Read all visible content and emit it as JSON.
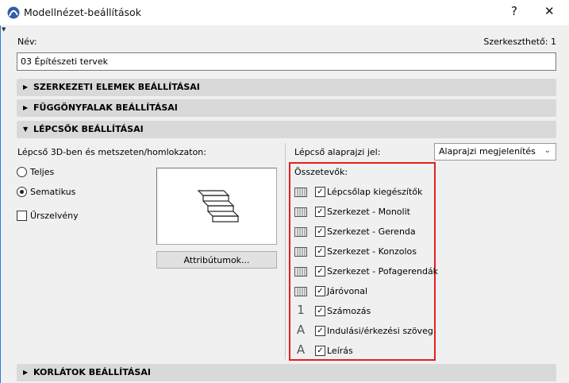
{
  "window": {
    "title": "Modellnézet-beállítások",
    "help_label": "?",
    "close_label": "✕"
  },
  "name": {
    "label": "Név:",
    "value": "03 Építészeti tervek",
    "editable_label": "Szerkeszthető: 1"
  },
  "sections": [
    {
      "label": "SZERKEZETI ELEMEK BEÁLLÍTÁSAI",
      "expanded": false
    },
    {
      "label": "FÜGGÖNYFALAK BEÁLLÍTÁSAI",
      "expanded": false
    },
    {
      "label": "LÉPCSŐK BEÁLLÍTÁSAI",
      "expanded": true
    },
    {
      "label": "KORLÁTOK BEÁLLÍTÁSAI",
      "expanded": false
    }
  ],
  "stairs": {
    "mode_label": "Lépcső 3D-ben és metszeten/homlokzaton:",
    "radio_full": "Teljes",
    "radio_schematic": "Sematikus",
    "selected": "Sematikus",
    "boundary_label": "Űrszelvény",
    "boundary_checked": false,
    "attributes_button": "Attribútumok...",
    "floorplan_label": "Lépcső alaprajzi jel:",
    "floorplan_value": "Alaprajzi megjelenítés",
    "components_label": "Összetevők:",
    "components": [
      {
        "label": "Lépcsőlap kiegészítők",
        "icon": "tread-accessories-icon",
        "checked": true
      },
      {
        "label": "Szerkezet - Monolit",
        "icon": "structure-monolithic-icon",
        "checked": true
      },
      {
        "label": "Szerkezet - Gerenda",
        "icon": "structure-beam-icon",
        "checked": true
      },
      {
        "label": "Szerkezet - Konzolos",
        "icon": "structure-cantilever-icon",
        "checked": true
      },
      {
        "label": "Szerkezet - Pofagerendák",
        "icon": "structure-stringers-icon",
        "checked": true
      },
      {
        "label": "Járóvonal",
        "icon": "walking-line-icon",
        "checked": true
      },
      {
        "label": "Számozás",
        "icon": "numbering-icon",
        "checked": true
      },
      {
        "label": "Indulási/érkezési szöveg",
        "icon": "text-icon",
        "checked": true
      },
      {
        "label": "Leírás",
        "icon": "text-icon",
        "checked": true
      }
    ]
  }
}
